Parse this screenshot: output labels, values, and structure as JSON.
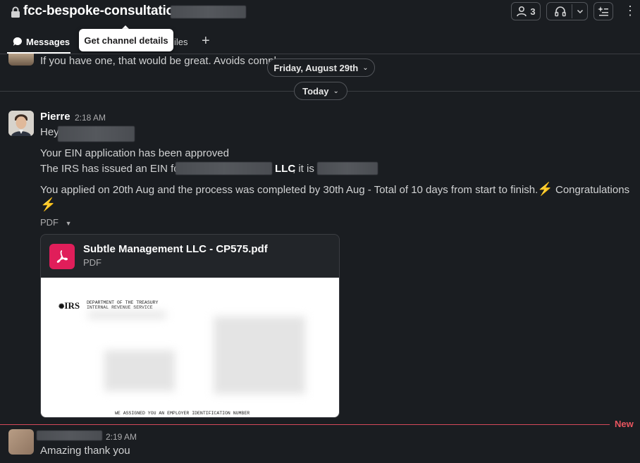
{
  "header": {
    "channel_name": "fcc-bespoke-consultation-",
    "member_count": "3",
    "tabs": {
      "messages": "Messages",
      "files_fragment": "iles"
    },
    "tooltip": "Get channel details"
  },
  "history": {
    "previous_message_fragment": "If you have one, that would be great. Avoids compl",
    "pill_past": "Friday, August 29th",
    "pill_today": "Today"
  },
  "message_1": {
    "author": "Pierre",
    "time": "2:18 AM",
    "greeting": "Hey",
    "line1": "Your EIN application has been approved",
    "line2_pre": "The IRS has issued an EIN for",
    "line2_llc": "LLC",
    "line2_post": ", it is",
    "line3": "You applied on 20th Aug and the process was completed by 30th Aug - Total of 10 days from start to finish. ",
    "congrats": "Congratulations",
    "emoji": "⚡",
    "attachment_toggle": "PDF",
    "file": {
      "name": "Subtle Management LLC - CP575.pdf",
      "type": "PDF",
      "preview_irs": "IRS",
      "preview_dept": "DEPARTMENT OF THE TREASURY",
      "preview_irs_full": "INTERNAL REVENUE SERVICE",
      "preview_footer": "WE ASSIGNED YOU AN EMPLOYER IDENTIFICATION NUMBER"
    }
  },
  "new_marker": "New",
  "message_2": {
    "time": "2:19 AM",
    "text": "Amazing thank you"
  },
  "colors": {
    "background": "#1a1d21",
    "new_marker": "#e8555f",
    "pdf_icon": "#e01e5a",
    "emoji": "#f2c037"
  }
}
